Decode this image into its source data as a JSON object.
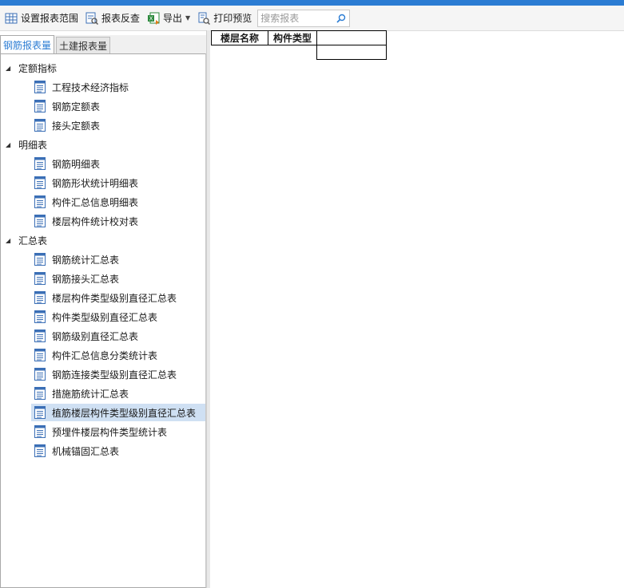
{
  "toolbar": {
    "set_range": "设置报表范围",
    "reverse_check": "报表反查",
    "export": "导出",
    "print_preview": "打印预览",
    "search_placeholder": "搜索报表"
  },
  "tabs": {
    "rebar": "钢筋报表量",
    "civil": "土建报表量"
  },
  "tree": {
    "groups": [
      {
        "label": "定额指标",
        "items": [
          "工程技术经济指标",
          "钢筋定额表",
          "接头定额表"
        ]
      },
      {
        "label": "明细表",
        "items": [
          "钢筋明细表",
          "钢筋形状统计明细表",
          "构件汇总信息明细表",
          "楼层构件统计校对表"
        ]
      },
      {
        "label": "汇总表",
        "items": [
          "钢筋统计汇总表",
          "钢筋接头汇总表",
          "楼层构件类型级别直径汇总表",
          "构件类型级别直径汇总表",
          "钢筋级别直径汇总表",
          "构件汇总信息分类统计表",
          "钢筋连接类型级别直径汇总表",
          "措施筋统计汇总表",
          "植筋楼层构件类型级别直径汇总表",
          "预埋件楼层构件类型统计表",
          "机械锚固汇总表"
        ]
      }
    ],
    "selected": "植筋楼层构件类型级别直径汇总表"
  },
  "report": {
    "col1": "楼层名称",
    "col2": "构件类型"
  },
  "colors": {
    "accent": "#2b7cd3",
    "selection": "#cfe0f3",
    "doc_icon": "#3b6fb6"
  },
  "icons": {
    "set_range": "grid-range-icon",
    "reverse_check": "reverse-lookup-icon",
    "export": "excel-export-icon",
    "print_preview": "print-preview-icon",
    "search": "search-icon",
    "doc": "report-doc-icon"
  }
}
